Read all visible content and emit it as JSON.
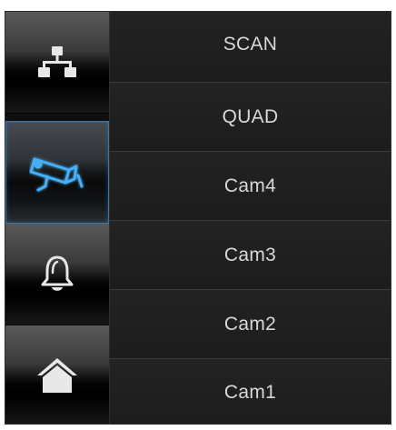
{
  "sidebar": {
    "buttons": [
      {
        "icon": "network-icon",
        "active": false
      },
      {
        "icon": "camera-icon",
        "active": true,
        "accent": "#3aa0e8"
      },
      {
        "icon": "bell-icon",
        "active": false
      },
      {
        "icon": "home-icon",
        "active": false
      }
    ]
  },
  "menu": {
    "items": [
      {
        "label": "SCAN"
      },
      {
        "label": "QUAD"
      },
      {
        "label": "Cam4"
      },
      {
        "label": "Cam3"
      },
      {
        "label": "Cam2"
      },
      {
        "label": "Cam1"
      }
    ]
  },
  "colors": {
    "background": "#202020",
    "text": "#d8d8d8",
    "accent": "#3aa0e8",
    "divider": "#3a3a3a"
  }
}
